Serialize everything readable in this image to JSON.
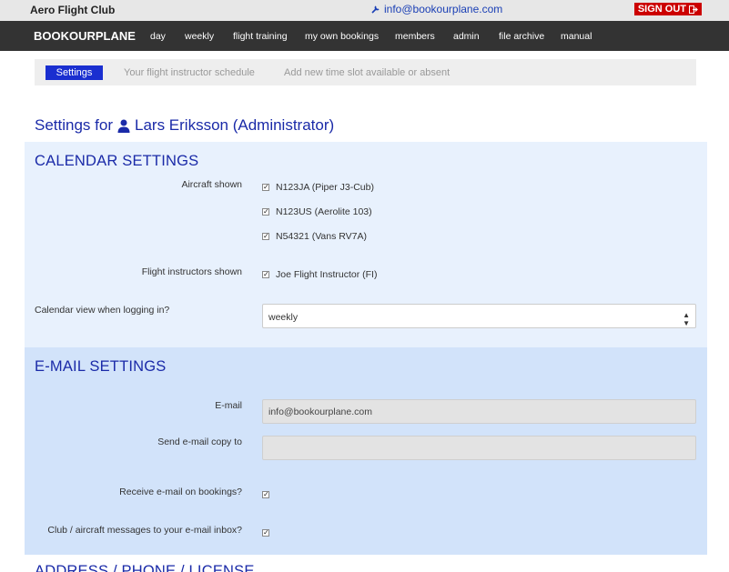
{
  "topbar": {
    "club_name": "Aero Flight Club",
    "email": "info@bookourplane.com",
    "signout": "SIGN OUT"
  },
  "nav": {
    "brand": "BOOKOURPLANE",
    "items": [
      "day",
      "weekly",
      "flight training",
      "my own bookings",
      "members",
      "admin",
      "file archive",
      "manual"
    ]
  },
  "subnav": {
    "active": "Settings",
    "links": [
      "Your flight instructor schedule",
      "Add new time slot available or absent"
    ]
  },
  "page_title": {
    "prefix": "Settings for",
    "user": "Lars Eriksson (Administrator)"
  },
  "calendar": {
    "title": "CALENDAR SETTINGS",
    "aircraft_label": "Aircraft shown",
    "aircraft": [
      "N123JA (Piper J3-Cub)",
      "N123US (Aerolite 103)",
      "N54321 (Vans RV7A)"
    ],
    "instructors_label": "Flight instructors shown",
    "instructors": [
      "Joe Flight Instructor (FI)"
    ],
    "view_label": "Calendar view when logging in?",
    "view_value": "weekly"
  },
  "email": {
    "title": "E-MAIL SETTINGS",
    "email_label": "E-mail",
    "email_value": "info@bookourplane.com",
    "copy_label": "Send e-mail copy to",
    "copy_value": "",
    "receive_label": "Receive e-mail on bookings?",
    "messages_label": "Club / aircraft messages to your e-mail inbox?"
  },
  "address": {
    "title": "ADDRESS / PHONE / LICENSE"
  },
  "colors": {
    "accent": "#1a2aa8",
    "navbar": "#333333",
    "signout": "#cc0000",
    "calendar_bg": "#e8f1fd",
    "email_bg": "#d2e3fa"
  }
}
